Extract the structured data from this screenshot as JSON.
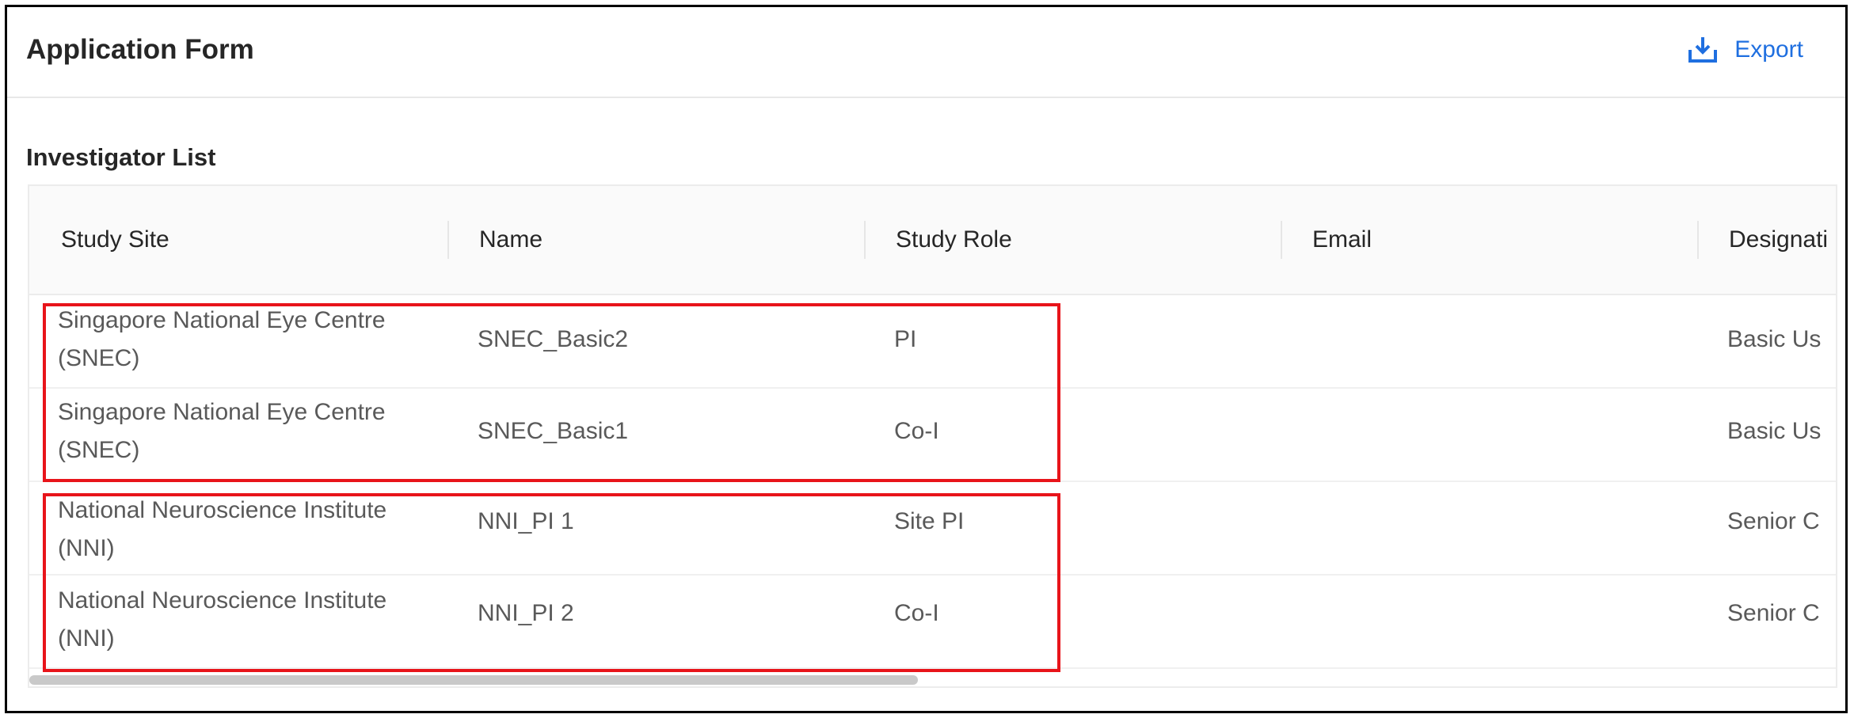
{
  "header": {
    "title": "Application Form",
    "export_label": "Export",
    "export_icon": "download-icon"
  },
  "section": {
    "title": "Investigator List"
  },
  "table": {
    "columns": [
      "Study Site",
      "Name",
      "Study Role",
      "Email",
      "Designati"
    ],
    "rows": [
      {
        "site_line1": "Singapore National Eye Centre",
        "site_line2": "(SNEC)",
        "name": "SNEC_Basic2",
        "role": "PI",
        "email": "",
        "designation": "Basic Us"
      },
      {
        "site_line1": "Singapore National Eye Centre",
        "site_line2": "(SNEC)",
        "name": "SNEC_Basic1",
        "role": "Co-I",
        "email": "",
        "designation": "Basic Us"
      },
      {
        "site_line1": "National Neuroscience Institute",
        "site_line2": "(NNI)",
        "name": "NNI_PI 1",
        "role": "Site PI",
        "email": "",
        "designation": "Senior C"
      },
      {
        "site_line1": "National Neuroscience Institute",
        "site_line2": "(NNI)",
        "name": "NNI_PI 2",
        "role": "Co-I",
        "email": "",
        "designation": "Senior C"
      }
    ]
  },
  "colors": {
    "accent": "#1f6fe0",
    "highlight": "#e8141a",
    "header_bg": "#fafafa"
  }
}
